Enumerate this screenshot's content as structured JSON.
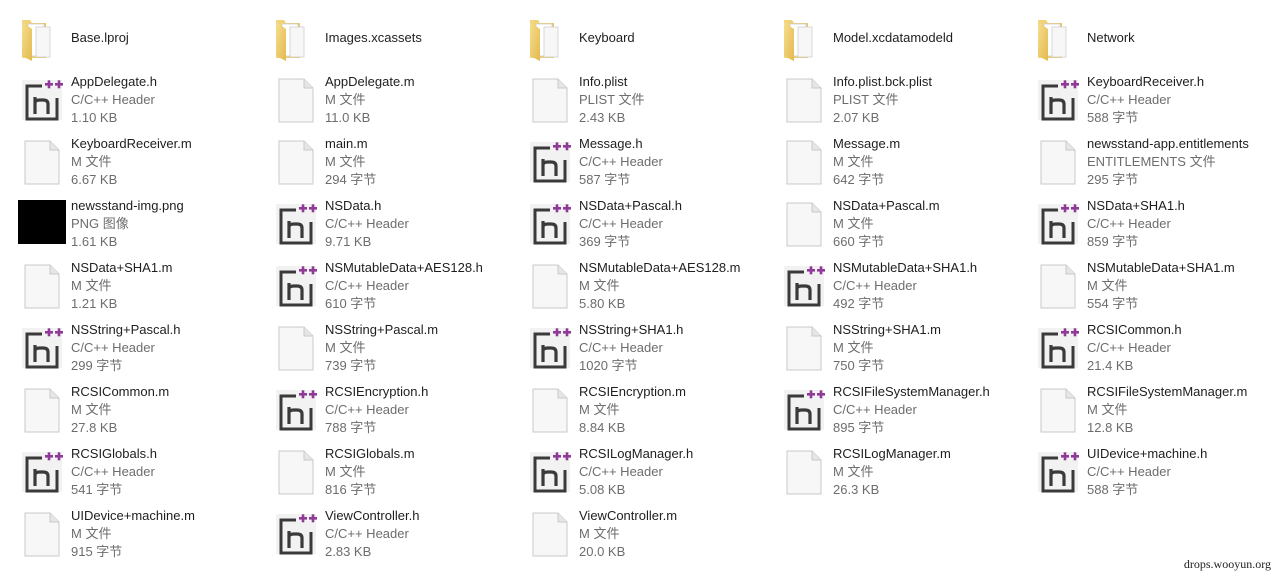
{
  "view": {
    "layout": "tiles",
    "columns": [
      [
        {
          "name": "Base.lproj",
          "kind": "folder"
        },
        {
          "name": "AppDelegate.h",
          "kind": "header",
          "type": "C/C++ Header",
          "size": "1.10 KB"
        },
        {
          "name": "KeyboardReceiver.m",
          "kind": "file",
          "type": "M 文件",
          "size": "6.67 KB"
        },
        {
          "name": "newsstand-img.png",
          "kind": "image",
          "type": "PNG 图像",
          "size": "1.61 KB"
        },
        {
          "name": "NSData+SHA1.m",
          "kind": "file",
          "type": "M 文件",
          "size": "1.21 KB"
        },
        {
          "name": "NSString+Pascal.h",
          "kind": "header",
          "type": "C/C++ Header",
          "size": "299 字节"
        },
        {
          "name": "RCSICommon.m",
          "kind": "file",
          "type": "M 文件",
          "size": "27.8 KB"
        },
        {
          "name": "RCSIGlobals.h",
          "kind": "header",
          "type": "C/C++ Header",
          "size": "541 字节"
        },
        {
          "name": "UIDevice+machine.m",
          "kind": "file",
          "type": "M 文件",
          "size": "915 字节"
        }
      ],
      [
        {
          "name": "Images.xcassets",
          "kind": "folder"
        },
        {
          "name": "AppDelegate.m",
          "kind": "file",
          "type": "M 文件",
          "size": "11.0 KB"
        },
        {
          "name": "main.m",
          "kind": "file",
          "type": "M 文件",
          "size": "294 字节"
        },
        {
          "name": "NSData.h",
          "kind": "header",
          "type": "C/C++ Header",
          "size": "9.71 KB"
        },
        {
          "name": "NSMutableData+AES128.h",
          "kind": "header",
          "type": "C/C++ Header",
          "size": "610 字节"
        },
        {
          "name": "NSString+Pascal.m",
          "kind": "file",
          "type": "M 文件",
          "size": "739 字节"
        },
        {
          "name": "RCSIEncryption.h",
          "kind": "header",
          "type": "C/C++ Header",
          "size": "788 字节"
        },
        {
          "name": "RCSIGlobals.m",
          "kind": "file",
          "type": "M 文件",
          "size": "816 字节"
        },
        {
          "name": "ViewController.h",
          "kind": "header",
          "type": "C/C++ Header",
          "size": "2.83 KB"
        }
      ],
      [
        {
          "name": "Keyboard",
          "kind": "folder"
        },
        {
          "name": "Info.plist",
          "kind": "file",
          "type": "PLIST 文件",
          "size": "2.43 KB"
        },
        {
          "name": "Message.h",
          "kind": "header",
          "type": "C/C++ Header",
          "size": "587 字节"
        },
        {
          "name": "NSData+Pascal.h",
          "kind": "header",
          "type": "C/C++ Header",
          "size": "369 字节"
        },
        {
          "name": "NSMutableData+AES128.m",
          "kind": "file",
          "type": "M 文件",
          "size": "5.80 KB"
        },
        {
          "name": "NSString+SHA1.h",
          "kind": "header",
          "type": "C/C++ Header",
          "size": "1020 字节"
        },
        {
          "name": "RCSIEncryption.m",
          "kind": "file",
          "type": "M 文件",
          "size": "8.84 KB"
        },
        {
          "name": "RCSILogManager.h",
          "kind": "header",
          "type": "C/C++ Header",
          "size": "5.08 KB"
        },
        {
          "name": "ViewController.m",
          "kind": "file",
          "type": "M 文件",
          "size": "20.0 KB"
        }
      ],
      [
        {
          "name": "Model.xcdatamodeld",
          "kind": "folder"
        },
        {
          "name": "Info.plist.bck.plist",
          "kind": "file",
          "type": "PLIST 文件",
          "size": "2.07 KB"
        },
        {
          "name": "Message.m",
          "kind": "file",
          "type": "M 文件",
          "size": "642 字节"
        },
        {
          "name": "NSData+Pascal.m",
          "kind": "file",
          "type": "M 文件",
          "size": "660 字节"
        },
        {
          "name": "NSMutableData+SHA1.h",
          "kind": "header",
          "type": "C/C++ Header",
          "size": "492 字节"
        },
        {
          "name": "NSString+SHA1.m",
          "kind": "file",
          "type": "M 文件",
          "size": "750 字节"
        },
        {
          "name": "RCSIFileSystemManager.h",
          "kind": "header",
          "type": "C/C++ Header",
          "size": "895 字节"
        },
        {
          "name": "RCSILogManager.m",
          "kind": "file",
          "type": "M 文件",
          "size": "26.3 KB"
        }
      ],
      [
        {
          "name": "Network",
          "kind": "folder"
        },
        {
          "name": "KeyboardReceiver.h",
          "kind": "header",
          "type": "C/C++ Header",
          "size": "588 字节"
        },
        {
          "name": "newsstand-app.entitlements",
          "kind": "file",
          "type": "ENTITLEMENTS 文件",
          "size": "295 字节"
        },
        {
          "name": "NSData+SHA1.h",
          "kind": "header",
          "type": "C/C++ Header",
          "size": "859 字节"
        },
        {
          "name": "NSMutableData+SHA1.m",
          "kind": "file",
          "type": "M 文件",
          "size": "554 字节"
        },
        {
          "name": "RCSICommon.h",
          "kind": "header",
          "type": "C/C++ Header",
          "size": "21.4 KB"
        },
        {
          "name": "RCSIFileSystemManager.m",
          "kind": "file",
          "type": "M 文件",
          "size": "12.8 KB"
        },
        {
          "name": "UIDevice+machine.h",
          "kind": "header",
          "type": "C/C++ Header",
          "size": "588 字节"
        }
      ]
    ]
  },
  "colors": {
    "header_plus": "#8e3a96",
    "header_frame": "#3a3a3a",
    "folder": "#f1d37a",
    "text_primary": "#1e1e1e",
    "text_secondary": "#6d6d6d"
  },
  "icons": {
    "folder": "folder-icon",
    "header": "cpp-header-file-icon",
    "file": "blank-file-icon",
    "image": "png-image-thumbnail"
  },
  "watermark": "drops.wooyun.org"
}
